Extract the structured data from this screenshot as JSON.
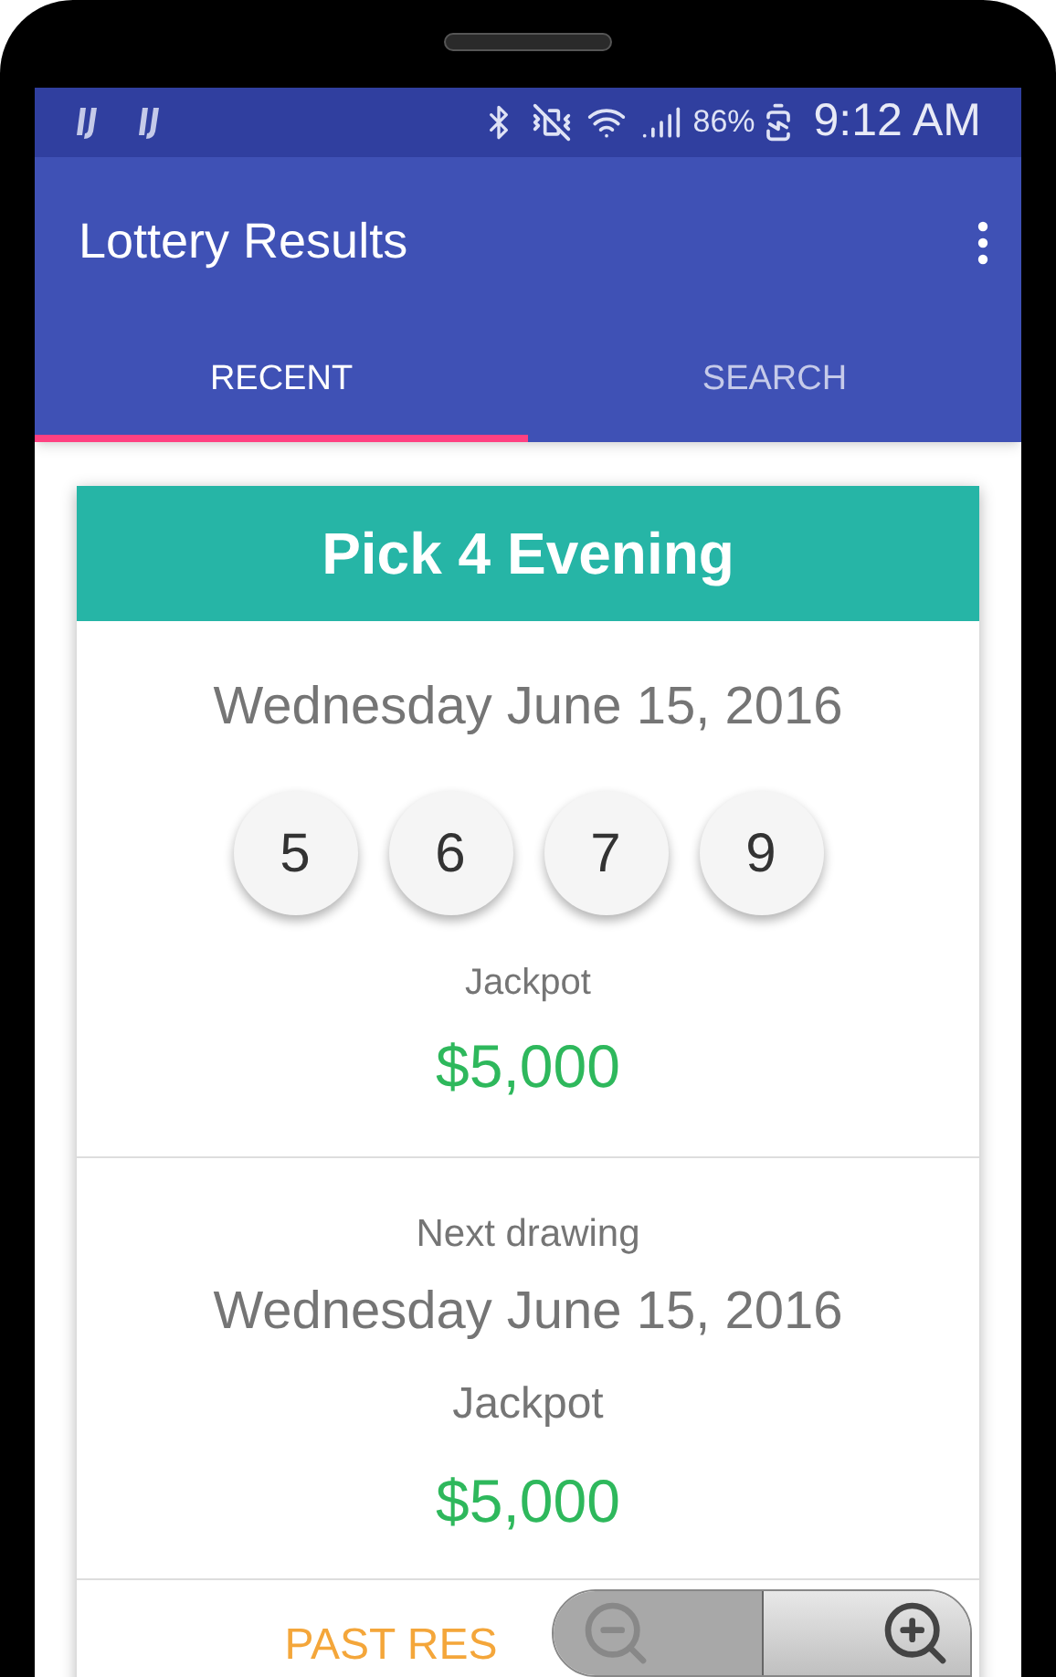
{
  "status_bar": {
    "battery": "86%",
    "time": "9:12 AM"
  },
  "app_bar": {
    "title": "Lottery Results"
  },
  "tabs": [
    {
      "label": "RECENT",
      "selected": true
    },
    {
      "label": "SEARCH",
      "selected": false
    }
  ],
  "card": {
    "title": "Pick 4 Evening",
    "date": "Wednesday June 15, 2016",
    "numbers": [
      "5",
      "6",
      "7",
      "9"
    ],
    "jackpot_label": "Jackpot",
    "jackpot": "$5,000",
    "next_label": "Next drawing",
    "next_date": "Wednesday June 15, 2016",
    "next_jackpot_label": "Jackpot",
    "next_jackpot": "$5,000",
    "past_results": "PAST RES"
  }
}
